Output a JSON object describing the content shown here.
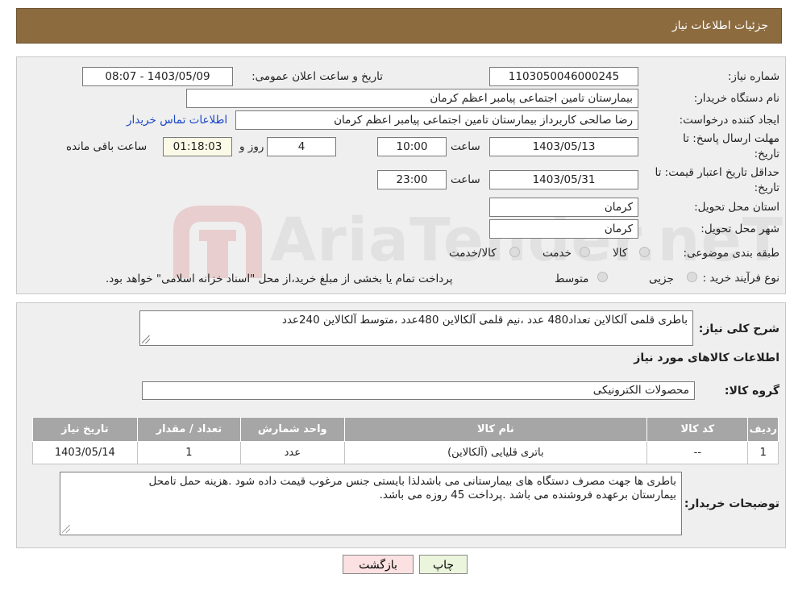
{
  "header": {
    "title": "جزئیات اطلاعات نیاز"
  },
  "form": {
    "need_number_label": "شماره نیاز:",
    "need_number": "1103050046000245",
    "announce_label": "تاریخ و ساعت اعلان عمومی:",
    "announce_value": "1403/05/09 - 08:07",
    "buyer_org_label": "نام دستگاه خریدار:",
    "buyer_org": "بیمارستان تامین اجتماعی پیامبر اعظم کرمان",
    "creator_label": "ایجاد کننده درخواست:",
    "creator": "رضا صالحی  کاربرداز بیمارستان تامین اجتماعی پیامبر اعظم کرمان",
    "contact_link": "اطلاعات تماس خریدار",
    "deadline_label_1": "مهلت ارسال پاسخ: تا",
    "deadline_label_2": "تاریخ:",
    "deadline_date": "1403/05/13",
    "time_label": "ساعت",
    "deadline_time": "10:00",
    "days_value": "4",
    "days_label": "روز و",
    "remaining_time": "01:18:03",
    "remaining_label": "ساعت باقی مانده",
    "validity_label_1": "حداقل تاریخ اعتبار قیمت: تا",
    "validity_label_2": "تاریخ:",
    "validity_date": "1403/05/31",
    "validity_time": "23:00",
    "province_label": "استان محل تحویل:",
    "province": "کرمان",
    "city_label": "شهر محل تحویل:",
    "city": "کرمان",
    "category_label": "طبقه بندی موضوعی:",
    "category_options": [
      "کالا",
      "خدمت",
      "کالا/خدمت"
    ],
    "process_label": "نوع فرآیند خرید :",
    "process_options": [
      "جزیی",
      "متوسط"
    ],
    "process_note": "پرداخت تمام یا بخشی از مبلغ خرید،از محل \"اسناد خزانه اسلامی\" خواهد بود."
  },
  "summary": {
    "label": "شرح کلی نیاز:",
    "text": "باطری قلمی آلکالاین تعداد480 عدد ،نیم قلمی آلکالاین 480عدد ،متوسط آلکالاین 240عدد",
    "goods_info_title": "اطلاعات کالاهای مورد نیاز",
    "group_label": "گروه کالا:",
    "group_value": "محصولات الکترونیکی"
  },
  "table": {
    "headers": [
      "ردیف",
      "کد کالا",
      "نام کالا",
      "واحد شمارش",
      "تعداد / مقدار",
      "تاریخ نیاز"
    ],
    "rows": [
      [
        "1",
        "--",
        "باتری قلیایی (آلکالاین)",
        "عدد",
        "1",
        "1403/05/14"
      ]
    ]
  },
  "notes": {
    "label": "توضیحات خریدار:",
    "line1": "باطری ها جهت مصرف دستگاه های بیمارستانی می باشدلذا بایستی جنس مرغوب قیمت داده شود .هزینه حمل تامحل",
    "line2": "بیمارستان برعهده فروشنده می باشد .پرداخت 45 روزه می باشد."
  },
  "buttons": {
    "print": "چاپ",
    "back": "بازگشت"
  },
  "watermark": {
    "text": "AriaTender.neT"
  },
  "colors": {
    "header": "#8c6b3f",
    "link": "#1a46c8",
    "back_button": "#fbe1e1",
    "print_button": "#eaf5dc"
  }
}
